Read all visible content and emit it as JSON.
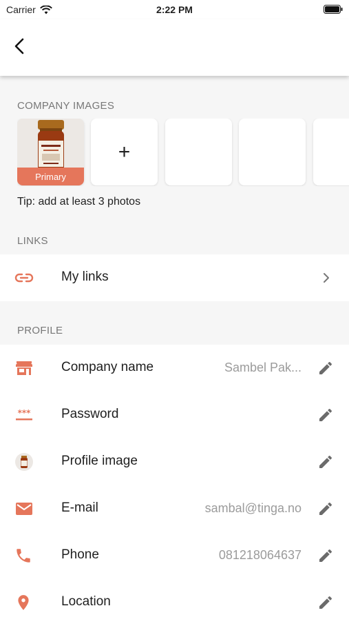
{
  "status_bar": {
    "carrier": "Carrier",
    "time": "2:22 PM"
  },
  "sections": {
    "company_images": "COMPANY IMAGES",
    "links": "LINKS",
    "profile": "PROFILE"
  },
  "images": {
    "primary_label": "Primary",
    "add_symbol": "+",
    "tip": "Tip: add at least 3 photos"
  },
  "links": {
    "my_links": "My links"
  },
  "profile": {
    "rows": [
      {
        "label": "Company name",
        "value": "Sambel Pak...",
        "icon": "store-icon"
      },
      {
        "label": "Password",
        "value": "",
        "icon": "password-icon"
      },
      {
        "label": "Profile image",
        "value": "",
        "icon": "profile-image-avatar"
      },
      {
        "label": "E-mail",
        "value": "sambal@tinga.no",
        "icon": "mail-icon"
      },
      {
        "label": "Phone",
        "value": "081218064637",
        "icon": "phone-icon"
      },
      {
        "label": "Location",
        "value": "",
        "icon": "location-pin-icon"
      }
    ]
  },
  "colors": {
    "accent": "#e5765b",
    "background": "#f6f6f6",
    "value_text": "#9b9b9b"
  }
}
